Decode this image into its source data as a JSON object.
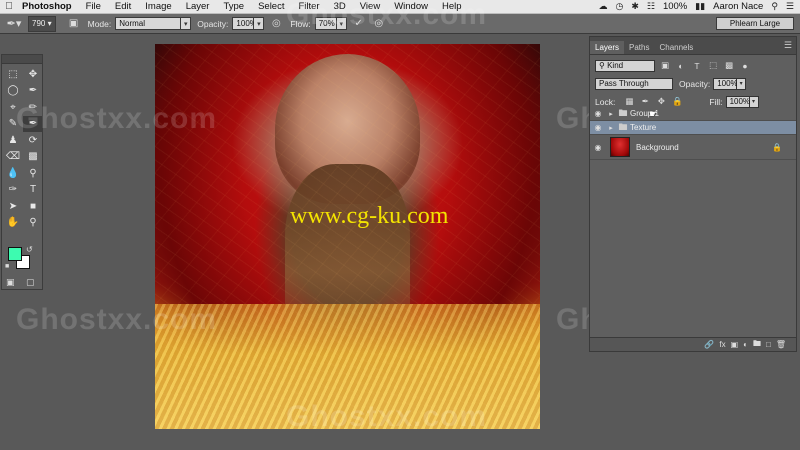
{
  "menubar": {
    "app_name": "Photoshop",
    "items": [
      "File",
      "Edit",
      "Image",
      "Layer",
      "Type",
      "Select",
      "Filter",
      "3D",
      "View",
      "Window",
      "Help"
    ],
    "battery": "100%",
    "user": "Aaron Nace"
  },
  "options": {
    "brush_size": "790",
    "mode_label": "Mode:",
    "mode_value": "Normal",
    "opacity_label": "Opacity:",
    "opacity_value": "100%",
    "flow_label": "Flow:",
    "flow_value": "70%",
    "workspace": "Phlearn Large"
  },
  "swatches": {
    "foreground": "#3dfbb0",
    "background": "#ffffff"
  },
  "watermarks": {
    "ghost": "Ghostxx.com",
    "url": "www.cg-ku.com"
  },
  "layers_panel": {
    "tabs": [
      "Layers",
      "Paths",
      "Channels"
    ],
    "kind_filter": "Kind",
    "blend_mode": "Pass Through",
    "opacity_label": "Opacity:",
    "opacity_value": "100%",
    "lock_label": "Lock:",
    "fill_label": "Fill:",
    "fill_value": "100%",
    "layers": [
      {
        "name": "Group 1",
        "type": "group",
        "selected": false
      },
      {
        "name": "Texture",
        "type": "group",
        "selected": true
      },
      {
        "name": "Background",
        "type": "image",
        "selected": false,
        "locked": true
      }
    ]
  }
}
